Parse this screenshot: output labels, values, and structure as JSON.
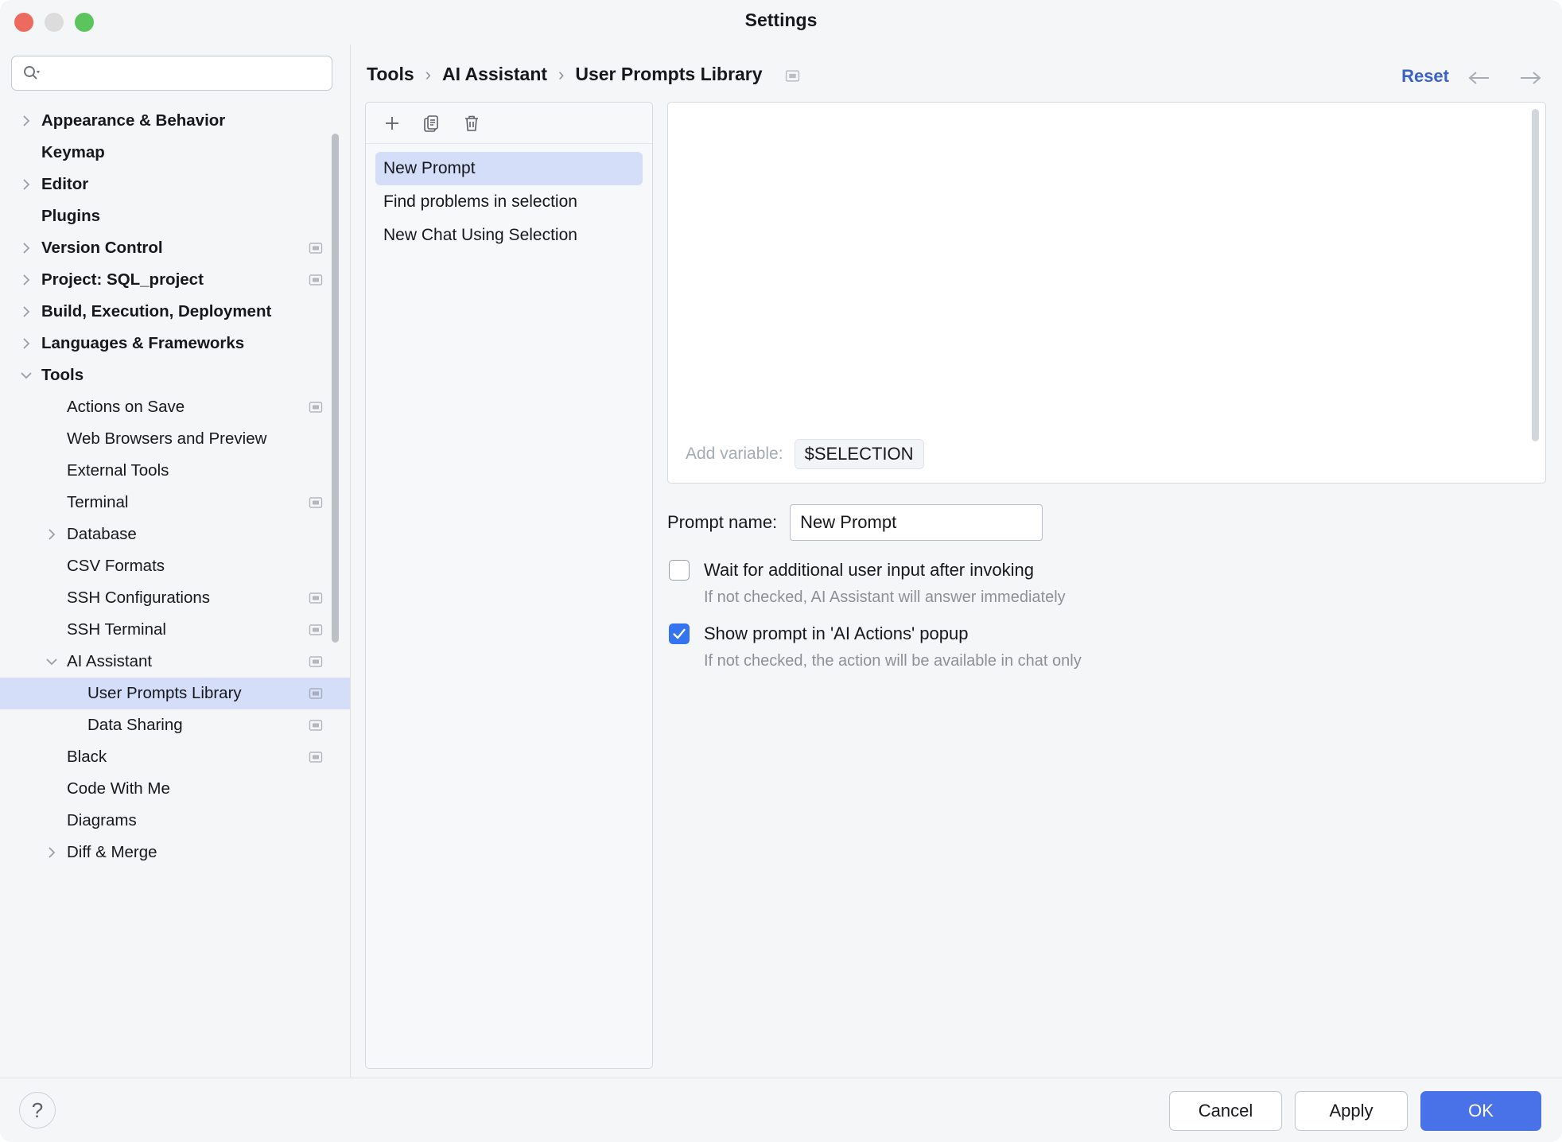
{
  "window": {
    "title": "Settings"
  },
  "traffic_lights": {
    "close": "close-button",
    "minimize": "minimize-button",
    "maximize": "maximize-button"
  },
  "search": {
    "value": "",
    "placeholder": ""
  },
  "sidebar": {
    "items": [
      {
        "label": "Appearance & Behavior",
        "level": 0,
        "twisty": "right",
        "bold": true,
        "badge": false,
        "selected": false
      },
      {
        "label": "Keymap",
        "level": 0,
        "twisty": "none",
        "bold": true,
        "badge": false,
        "selected": false
      },
      {
        "label": "Editor",
        "level": 0,
        "twisty": "right",
        "bold": true,
        "badge": false,
        "selected": false
      },
      {
        "label": "Plugins",
        "level": 0,
        "twisty": "none",
        "bold": true,
        "badge": false,
        "selected": false
      },
      {
        "label": "Version Control",
        "level": 0,
        "twisty": "right",
        "bold": true,
        "badge": true,
        "selected": false
      },
      {
        "label": "Project: SQL_project",
        "level": 0,
        "twisty": "right",
        "bold": true,
        "badge": true,
        "selected": false
      },
      {
        "label": "Build, Execution, Deployment",
        "level": 0,
        "twisty": "right",
        "bold": true,
        "badge": false,
        "selected": false
      },
      {
        "label": "Languages & Frameworks",
        "level": 0,
        "twisty": "right",
        "bold": true,
        "badge": false,
        "selected": false
      },
      {
        "label": "Tools",
        "level": 0,
        "twisty": "down",
        "bold": true,
        "badge": false,
        "selected": false
      },
      {
        "label": "Actions on Save",
        "level": 1,
        "twisty": "none",
        "bold": false,
        "badge": true,
        "selected": false
      },
      {
        "label": "Web Browsers and Preview",
        "level": 1,
        "twisty": "none",
        "bold": false,
        "badge": false,
        "selected": false
      },
      {
        "label": "External Tools",
        "level": 1,
        "twisty": "none",
        "bold": false,
        "badge": false,
        "selected": false
      },
      {
        "label": "Terminal",
        "level": 1,
        "twisty": "none",
        "bold": false,
        "badge": true,
        "selected": false
      },
      {
        "label": "Database",
        "level": 1,
        "twisty": "right",
        "bold": false,
        "badge": false,
        "selected": false
      },
      {
        "label": "CSV Formats",
        "level": 1,
        "twisty": "none",
        "bold": false,
        "badge": false,
        "selected": false
      },
      {
        "label": "SSH Configurations",
        "level": 1,
        "twisty": "none",
        "bold": false,
        "badge": true,
        "selected": false
      },
      {
        "label": "SSH Terminal",
        "level": 1,
        "twisty": "none",
        "bold": false,
        "badge": true,
        "selected": false
      },
      {
        "label": "AI Assistant",
        "level": 1,
        "twisty": "down",
        "bold": false,
        "badge": true,
        "selected": false
      },
      {
        "label": "User Prompts Library",
        "level": 2,
        "twisty": "none",
        "bold": false,
        "badge": true,
        "selected": true
      },
      {
        "label": "Data Sharing",
        "level": 2,
        "twisty": "none",
        "bold": false,
        "badge": true,
        "selected": false
      },
      {
        "label": "Black",
        "level": 1,
        "twisty": "none",
        "bold": false,
        "badge": true,
        "selected": false
      },
      {
        "label": "Code With Me",
        "level": 1,
        "twisty": "none",
        "bold": false,
        "badge": false,
        "selected": false
      },
      {
        "label": "Diagrams",
        "level": 1,
        "twisty": "none",
        "bold": false,
        "badge": false,
        "selected": false
      },
      {
        "label": "Diff & Merge",
        "level": 1,
        "twisty": "right",
        "bold": false,
        "badge": false,
        "selected": false
      }
    ]
  },
  "header": {
    "breadcrumb": [
      "Tools",
      "AI Assistant",
      "User Prompts Library"
    ],
    "separator": "›",
    "reset_label": "Reset",
    "back_icon": "arrow-left-icon",
    "forward_icon": "arrow-right-icon"
  },
  "prompt_list": {
    "toolbar": [
      {
        "name": "add-prompt-button",
        "icon": "plus-icon"
      },
      {
        "name": "duplicate-prompt-button",
        "icon": "copy-icon"
      },
      {
        "name": "delete-prompt-button",
        "icon": "trash-icon"
      }
    ],
    "items": [
      {
        "label": "New Prompt",
        "selected": true
      },
      {
        "label": "Find problems in selection",
        "selected": false
      },
      {
        "label": "New Chat Using Selection",
        "selected": false
      }
    ]
  },
  "editor": {
    "text": "",
    "add_variable_label": "Add variable:",
    "variable_chip": "$SELECTION"
  },
  "form": {
    "prompt_name_label": "Prompt name:",
    "prompt_name_value": "New Prompt",
    "checkboxes": [
      {
        "label": "Wait for additional user input after invoking",
        "hint": "If not checked, AI Assistant will answer immediately",
        "checked": false
      },
      {
        "label": "Show prompt in 'AI Actions' popup",
        "hint": "If not checked, the action will be available in chat only",
        "checked": true
      }
    ]
  },
  "footer": {
    "help_label": "?",
    "cancel_label": "Cancel",
    "apply_label": "Apply",
    "ok_label": "OK"
  },
  "colors": {
    "accent_blue": "#4a72e8",
    "link_blue": "#3b62c9",
    "selection_blue": "#d4def9",
    "checkbox_blue": "#3574f0",
    "window_bg": "#f5f6f8"
  }
}
